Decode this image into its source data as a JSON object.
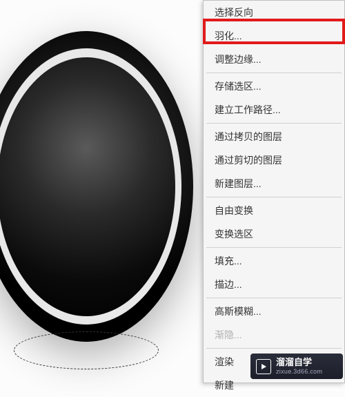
{
  "menu": {
    "items": [
      {
        "label": "选择反向",
        "disabled": false
      },
      {
        "label": "羽化...",
        "disabled": false,
        "highlighted": true
      },
      {
        "label": "调整边缘...",
        "disabled": false
      },
      {
        "separator": true
      },
      {
        "label": "存储选区...",
        "disabled": false
      },
      {
        "label": "建立工作路径...",
        "disabled": false
      },
      {
        "separator": true
      },
      {
        "label": "通过拷贝的图层",
        "disabled": false
      },
      {
        "label": "通过剪切的图层",
        "disabled": false
      },
      {
        "label": "新建图层...",
        "disabled": false
      },
      {
        "separator": true
      },
      {
        "label": "自由变换",
        "disabled": false
      },
      {
        "label": "变换选区",
        "disabled": false
      },
      {
        "separator": true
      },
      {
        "label": "填充...",
        "disabled": false
      },
      {
        "label": "描边...",
        "disabled": false
      },
      {
        "separator": true
      },
      {
        "label": "高斯模糊...",
        "disabled": false
      },
      {
        "label": "渐隐...",
        "disabled": true
      },
      {
        "separator": true
      },
      {
        "label": "渲染",
        "disabled": false
      },
      {
        "label": "新建",
        "disabled": false
      }
    ]
  },
  "highlight": {
    "color": "#e21a1a"
  },
  "watermark": {
    "title": "溜溜自学",
    "subtitle": "zixue.3d66.com"
  }
}
